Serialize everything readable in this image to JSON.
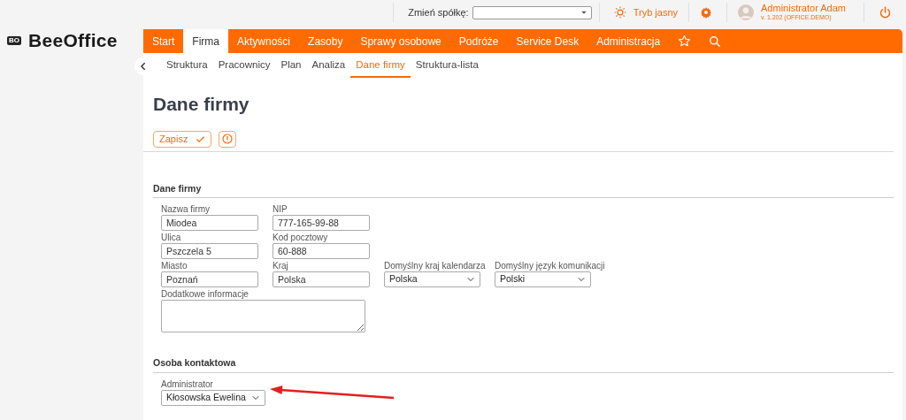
{
  "topbar": {
    "company_label": "Zmień spółkę:",
    "theme_label": "Tryb jasny",
    "user_name": "Administrator Adam",
    "version": "v. 1.202 (OFFICE.DEMO)"
  },
  "logo": {
    "badge": "BO",
    "text": "BeeOffice"
  },
  "main_nav": [
    {
      "label": "Start",
      "selected": false
    },
    {
      "label": "Firma",
      "selected": true
    },
    {
      "label": "Aktywności",
      "selected": false
    },
    {
      "label": "Zasoby",
      "selected": false
    },
    {
      "label": "Sprawy osobowe",
      "selected": false
    },
    {
      "label": "Podróże",
      "selected": false
    },
    {
      "label": "Service Desk",
      "selected": false
    },
    {
      "label": "Administracja",
      "selected": false
    }
  ],
  "sub_nav": [
    {
      "label": "Struktura",
      "selected": false
    },
    {
      "label": "Pracownicy",
      "selected": false
    },
    {
      "label": "Plan",
      "selected": false
    },
    {
      "label": "Analiza",
      "selected": false
    },
    {
      "label": "Dane firmy",
      "selected": true
    },
    {
      "label": "Struktura-lista",
      "selected": false
    }
  ],
  "page_title": "Dane firmy",
  "toolbar": {
    "save_label": "Zapisz"
  },
  "sections": [
    {
      "title": "Dane firmy",
      "rows": [
        [
          {
            "kind": "input",
            "label": "Nazwa firmy",
            "value": "Miodea"
          },
          {
            "kind": "input",
            "label": "NIP",
            "value": "777-165-99-88"
          }
        ],
        [
          {
            "kind": "input",
            "label": "Ulica",
            "value": "Pszczela 5"
          },
          {
            "kind": "input",
            "label": "Kod pocztowy",
            "value": "60-888"
          }
        ],
        [
          {
            "kind": "input",
            "label": "Miasto",
            "value": "Poznań"
          },
          {
            "kind": "input",
            "label": "Kraj",
            "value": "Polska"
          },
          {
            "kind": "select",
            "label": "Domyślny kraj kalendarza",
            "value": "Polska"
          },
          {
            "kind": "select",
            "label": "Domyślny język komunikacji",
            "value": "Polski"
          }
        ],
        [
          {
            "kind": "textarea",
            "label": "Dodatkowe informacje"
          }
        ]
      ]
    },
    {
      "title": "Osoba kontaktowa",
      "rows": [
        [
          {
            "kind": "select",
            "label": "Administrator",
            "value": "Kłosowska Ewelina"
          }
        ]
      ]
    }
  ]
}
